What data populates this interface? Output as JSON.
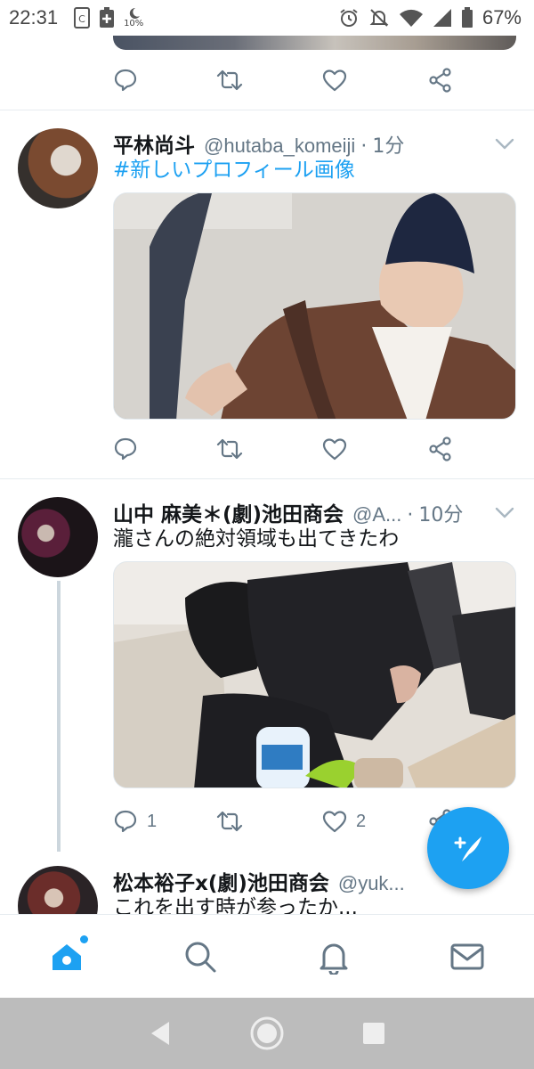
{
  "status_bar": {
    "time": "22:31",
    "moon_pct": "10%",
    "battery": "67%"
  },
  "tweets": [
    {
      "name": "平林尚斗",
      "handle": "@hutaba_komeiji",
      "sep": "·",
      "time": "1分",
      "text": "#新しいプロフィール画像"
    },
    {
      "name": "山中 麻美＊(劇)池田商会",
      "handle": "@A...",
      "sep": "·",
      "time": "10分",
      "text": "瀧さんの絶対領域も出てきたわ",
      "reply_count": "1",
      "like_count": "2"
    },
    {
      "name": "松本裕子x(劇)池田商会",
      "handle": "@yuk...",
      "text": "これを出す時が参ったか..."
    }
  ],
  "icons": {
    "reply": "reply-icon",
    "retweet": "retweet-icon",
    "like": "heart-icon",
    "share": "share-icon",
    "compose": "compose-tweet-icon",
    "home": "home-icon",
    "search": "search-icon",
    "notifications": "bell-icon",
    "messages": "mail-icon"
  },
  "colors": {
    "accent": "#1da1f2",
    "secondary_text": "#657786",
    "nav_bar": "#bcbcbc"
  }
}
